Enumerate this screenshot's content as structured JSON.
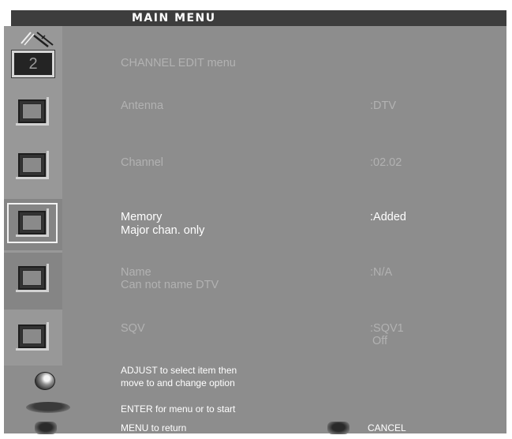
{
  "header": {
    "title": "MAIN MENU"
  },
  "channel_badge": "2",
  "menu": {
    "heading": "CHANNEL EDIT menu",
    "items": [
      {
        "label": "Antenna",
        "value": ":DTV"
      },
      {
        "label": "Channel",
        "value": ":02.02"
      },
      {
        "label": "Memory",
        "sublabel": "Major chan. only",
        "value": ":Added",
        "selected": true
      },
      {
        "label": "Name",
        "sublabel": "Can not name DTV",
        "value": ":N/A"
      },
      {
        "label": "SQV",
        "value": ":SQV1",
        "subvalue": "Off"
      }
    ]
  },
  "help": {
    "adjust_line1": "ADJUST to select item then",
    "adjust_line2": "move to and change option",
    "enter": "ENTER for menu or to start",
    "menu": "MENU to return",
    "cancel": "CANCEL"
  },
  "colors": {
    "panel": "#8d8d8d",
    "title_bar": "#3d3d3d",
    "selected_text": "#ffffff",
    "dim_text": "#b2b2b2"
  },
  "icons": [
    "antenna-icon",
    "square-button-icon",
    "jog-dial-icon",
    "enter-button-icon",
    "menu-button-icon",
    "cancel-button-icon"
  ]
}
